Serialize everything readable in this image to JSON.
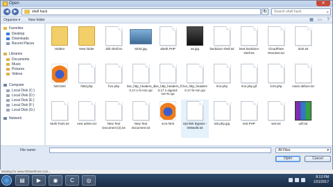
{
  "window": {
    "title": "Open",
    "close_label": "✕"
  },
  "nav": {
    "back": "◀",
    "forward": "▶",
    "path": "shell hack",
    "refresh": "↻",
    "search_placeholder": "Search shell hack"
  },
  "toolbar": {
    "organize": "Organize ▾",
    "new_folder": "New folder"
  },
  "sidebar": {
    "favorites": "Favorites",
    "items": [
      "Desktop",
      "Downloads",
      "Recent Places"
    ],
    "libraries": "Libraries",
    "lib_items": [
      "Documents",
      "Music",
      "Pictures",
      "Videos"
    ],
    "computer": "Computer",
    "drives": [
      "Local Disk (C:)",
      "Local Disk (D:)",
      "Local Disk (E:)",
      "Local Disk (F:)",
      "Local Disk (G:)"
    ],
    "network": "Network"
  },
  "files": {
    "row1": [
      "Hidden",
      "New folder",
      "2kb shell.txt",
      "8232.jpg",
      "abeth.PHP",
      "as.jpg",
      "backdoor shell.txt",
      "best backdoor shell.txt",
      "CloudFlare Resolver.txt",
      "dork.txt"
    ],
    "row2": [
      "hi0t.html",
      "hl0d.php",
      "hvn.php",
      "live_http_headers_clone 0.17.1-fx+sm.xpi",
      "live_http_headers_fixed_by_danielhd-0.17.1-signed-sm+fx.xpi",
      "live_http_headers 0.17-fx+sm.xpi",
      "lmn.php",
      "lmn.php.gif",
      "lcmt.php",
      "mass deface.txt"
    ],
    "row3": [
      "Multi Tools.txt",
      "new admin.txt",
      "New Text Document (2).txt",
      "New Text Document.txt",
      "scm.html",
      "Symlink Bypass - 000webt.txt",
      "tah.php.jpg",
      "test.PHP",
      "test.txt",
      "udf.rar"
    ]
  },
  "footer": {
    "filename_label": "File name:",
    "filter": "All Files",
    "open": "Open",
    "cancel": "Cancel"
  },
  "status": "Waiting for www.000webhost.com...",
  "clock": {
    "time": "8:13 PM",
    "date": "1/31/2017"
  }
}
